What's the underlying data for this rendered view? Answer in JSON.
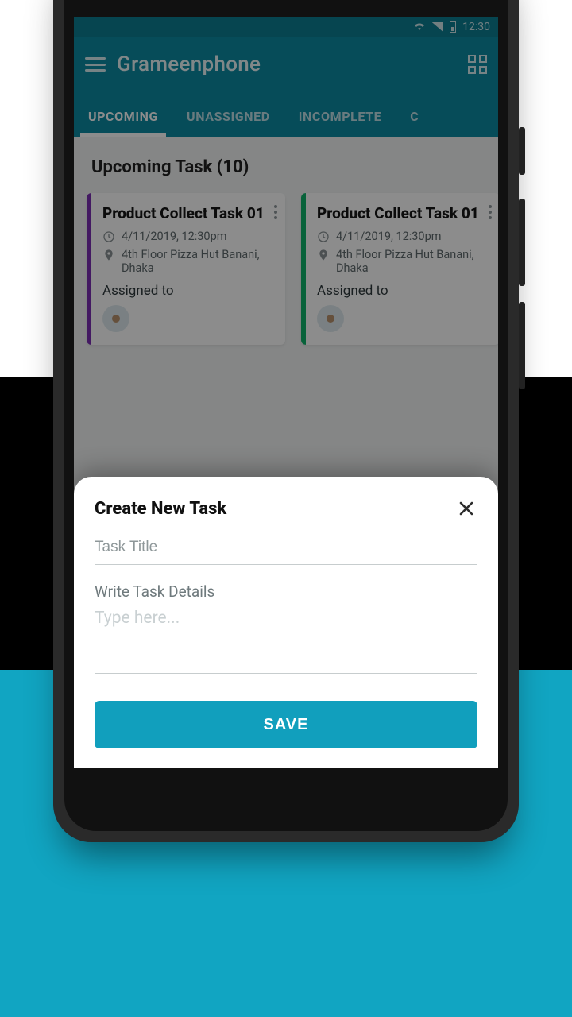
{
  "status": {
    "time": "12:30"
  },
  "header": {
    "title": "Grameenphone"
  },
  "tabs": [
    "UPCOMING",
    "UNASSIGNED",
    "INCOMPLETE",
    "C"
  ],
  "section": {
    "heading": "Upcoming Task (10)"
  },
  "cards": [
    {
      "title": "Product Collect Task 01",
      "datetime": "4/11/2019, 12:30pm",
      "location": "4th Floor Pizza Hut Banani, Dhaka",
      "assigned_label": "Assigned to",
      "accent": "#7b2fb3"
    },
    {
      "title": "Product Collect Task 01",
      "datetime": "4/11/2019, 12:30pm",
      "location": "4th Floor Pizza Hut Banani, Dhaka",
      "assigned_label": "Assigned to",
      "accent": "#0fb36b"
    }
  ],
  "sheet": {
    "title": "Create New Task",
    "title_placeholder": "Task Title",
    "details_label": "Write Task Details",
    "details_placeholder": "Type here...",
    "save_label": "SAVE"
  },
  "colors": {
    "brand_teal": "#0c8ba3",
    "action_teal": "#119fbd",
    "status_teal_dark": "#0c7e93"
  }
}
